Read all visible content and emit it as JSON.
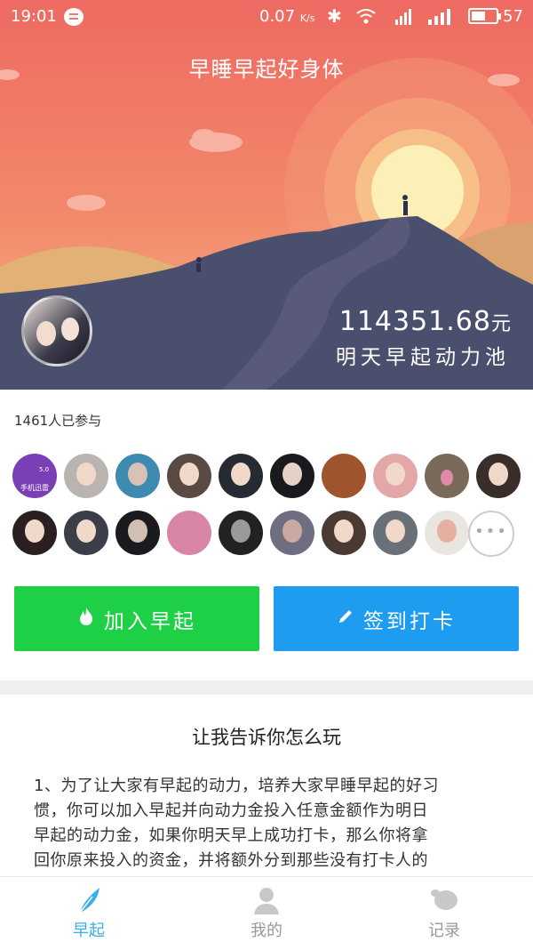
{
  "status_bar": {
    "time": "19:01",
    "network_speed": "0.07",
    "speed_unit": "K/s",
    "battery_level": "57",
    "battery_fraction": 0.57
  },
  "hero": {
    "title": "早睡早起好身体",
    "pool_amount": "114351.68",
    "pool_currency": "元",
    "pool_label": "明天早起动力池"
  },
  "participants": {
    "count_label": "1461人已参与",
    "brand_avatar_label": "手机迅雷",
    "brand_avatar_version": "5.0",
    "more_label": "•••"
  },
  "actions": {
    "join_label": "加入早起",
    "checkin_label": "签到打卡"
  },
  "howto": {
    "title": "让我告诉你怎么玩",
    "lines": [
      "1、为了让大家有早起的动力，培养大家早睡早起的好习",
      "惯，你可以加入早起并向动力金投入任意金额作为明日",
      "早起的动力金，如果你明天早上成功打卡，那么你将拿",
      "回你原来投入的资金，并将额外分到那些没有打卡人的"
    ]
  },
  "tabs": [
    {
      "label": "早起",
      "color": "#3aaee8",
      "active": true
    },
    {
      "label": "我的",
      "color": "#999999",
      "active": false
    },
    {
      "label": "记录",
      "color": "#999999",
      "active": false
    }
  ],
  "colors": {
    "join_green": "#1ed045",
    "checkin_blue": "#1e9df0",
    "sky_top": "#ee6a62",
    "sun": "#fcefb7"
  }
}
